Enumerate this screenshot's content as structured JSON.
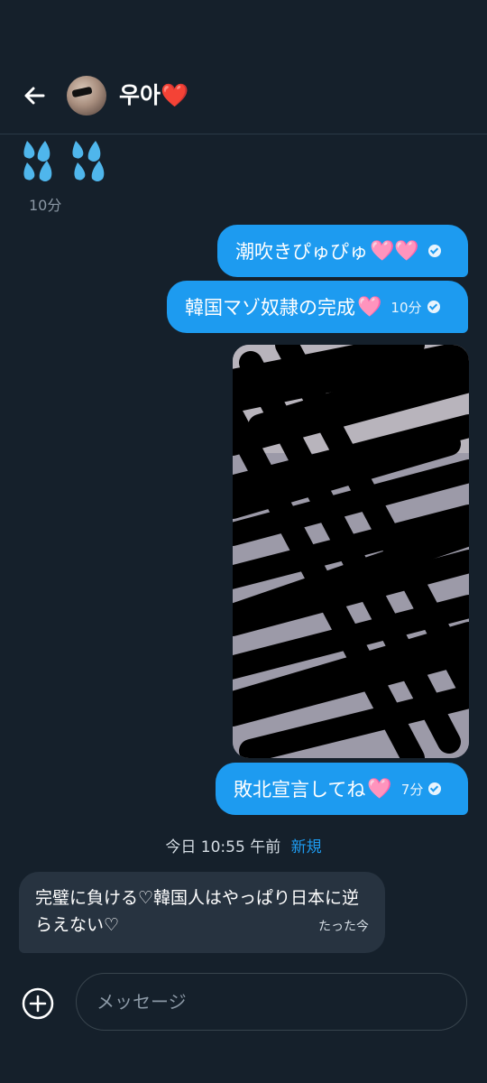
{
  "header": {
    "contact_name": "우아",
    "name_heart": "❤️"
  },
  "messages": {
    "received_emoji": "💦💦",
    "received_emoji_time": "10分",
    "out1_text": "潮吹きぴゅぴゅ",
    "out1_hearts": "🩷🩷",
    "out2_text": "韓国マゾ奴隷の完成",
    "out2_heart": "🩷",
    "out2_time": "10分",
    "out3_text": "敗北宣言してね",
    "out3_heart": "🩷",
    "out3_time": "7分",
    "in_text": "完璧に負ける♡韓国人はやっぱり日本に逆らえない♡",
    "in_time": "たった今"
  },
  "divider": {
    "date": "今日 10:55 午前",
    "new_label": "新規"
  },
  "composer": {
    "placeholder": "メッセージ"
  },
  "colors": {
    "background": "#15202b",
    "accent": "#1d9bf0",
    "incoming": "#273340"
  }
}
